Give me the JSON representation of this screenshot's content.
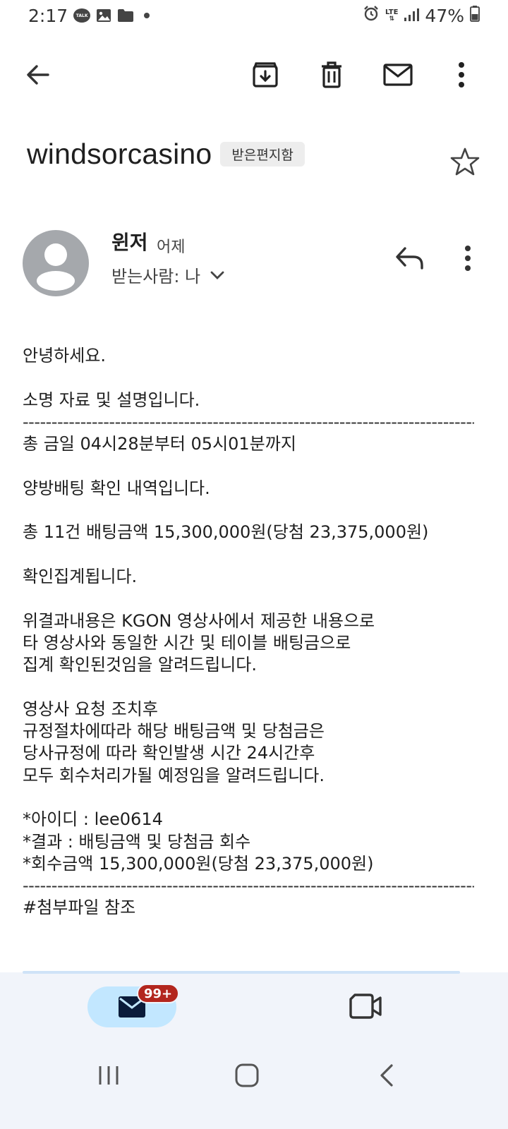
{
  "status_bar": {
    "time": "2:17",
    "talk_label": "TALK",
    "lte_label": "LTE",
    "battery": "47%",
    "icons": [
      "kakaotalk-icon",
      "gallery-icon",
      "folder-icon",
      "dot-icon",
      "alarm-icon",
      "lte-icon",
      "signal-icon",
      "battery-icon"
    ]
  },
  "toolbar": {
    "icons": [
      "back-arrow-icon",
      "archive-icon",
      "delete-icon",
      "mark-unread-icon",
      "more-vert-icon"
    ]
  },
  "email": {
    "subject": "windsorcasino",
    "label": "받은편지함",
    "sender_name": "윈저",
    "date": "어제",
    "recipient": "받는사람: 나",
    "body_lines": [
      "안녕하세요.",
      "",
      "소명 자료 및 설명입니다.",
      "-----------------------------------------------------------------------------------",
      "총 금일 04시28분부터 05시01분까지",
      "",
      "양방배팅 확인 내역입니다.",
      "",
      "총 11건 배팅금액 15,300,000원(당첨 23,375,000원)",
      "",
      "확인집계됩니다.",
      "",
      "위결과내용은 KGON 영상사에서 제공한 내용으로",
      "타 영상사와 동일한 시간 및 테이블 배팅금으로",
      "집계 확인된것임을 알려드립니다.",
      "",
      "영상사 요청 조치후",
      "규정절차에따라 해당 배팅금액 및 당첨금은",
      "당사규정에 따라 확인발생 시간 24시간후",
      "모두 회수처리가될 예정임을 알려드립니다.",
      "",
      "*아이디 : lee0614",
      "*결과 : 배팅금액 및 당첨금 회수",
      "*회수금액 15,300,000원(당첨 23,375,000원)",
      "-----------------------------------------------------------------------------------",
      "#첨부파일 참조"
    ]
  },
  "bottom_nav": {
    "mail_badge": "99+"
  },
  "colors": {
    "accent_pill": "#c2e7ff",
    "badge": "#b3261e",
    "nav_bg": "#f1f4fa",
    "avatar": "#a5a8ac"
  }
}
